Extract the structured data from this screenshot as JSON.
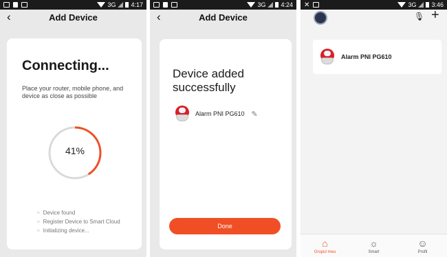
{
  "screens": [
    {
      "status": {
        "time": "4:17",
        "network": "3G"
      },
      "appbar": {
        "back": "‹",
        "title": "Add Device"
      },
      "card": {
        "title": "Connecting...",
        "subtitle": "Place your router, mobile phone, and device as close as possible",
        "progress_label": "41%",
        "progress_fraction": 0.41,
        "steps": [
          "Device found",
          "Register Device to Smart Cloud",
          "Initializing device..."
        ]
      }
    },
    {
      "status": {
        "time": "4:24",
        "network": "3G"
      },
      "appbar": {
        "back": "‹",
        "title": "Add Device"
      },
      "card": {
        "title": "Device added successfully",
        "device_name": "Alarm PNI PG610",
        "done_label": "Done"
      }
    },
    {
      "status": {
        "time": "3:46",
        "network": "3G"
      },
      "home": {
        "device_name": "Alarm PNI PG610",
        "tabs": [
          {
            "label": "Grupul meu",
            "icon": "home-icon",
            "active": true
          },
          {
            "label": "Smart",
            "icon": "sun-icon",
            "active": false
          },
          {
            "label": "Profil",
            "icon": "profile-icon",
            "active": false
          }
        ]
      }
    }
  ],
  "colors": {
    "accent": "#f04f25",
    "ring_track": "#d9d9d9",
    "status_bar": "#1b1b1b"
  }
}
